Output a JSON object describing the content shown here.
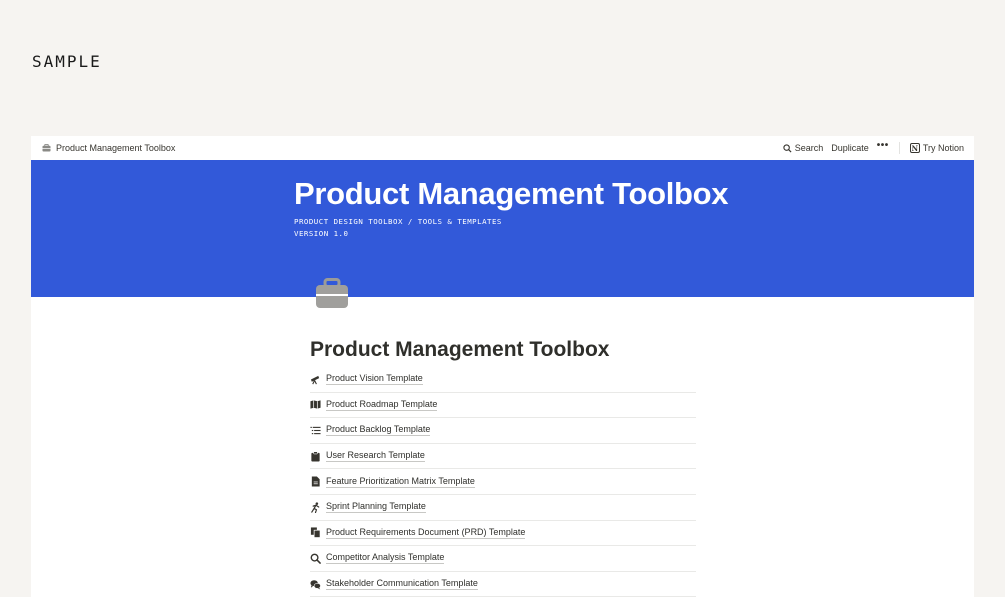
{
  "watermark": "SAMPLE",
  "topbar": {
    "breadcrumb": "Product Management Toolbox",
    "search_label": "Search",
    "duplicate_label": "Duplicate",
    "more_label": "•••",
    "notion_logo": "N",
    "try_label": "Try Notion"
  },
  "cover": {
    "title": "Product Management Toolbox",
    "subtitle_line1": "PRODUCT DESIGN TOOLBOX / TOOLS & TEMPLATES",
    "subtitle_line2": "VERSION 1.0",
    "color": "#3259d9"
  },
  "page": {
    "icon": "briefcase-icon",
    "title": "Product Management Toolbox"
  },
  "links": [
    {
      "label": "Product Vision Template",
      "icon": "telescope-icon"
    },
    {
      "label": "Product Roadmap Template",
      "icon": "map-icon"
    },
    {
      "label": "Product Backlog Template",
      "icon": "list-icon"
    },
    {
      "label": "User Research Template",
      "icon": "clipboard-icon"
    },
    {
      "label": "Feature Prioritization Matrix Template",
      "icon": "document-icon"
    },
    {
      "label": "Sprint Planning Template",
      "icon": "runner-icon"
    },
    {
      "label": "Product Requirements Document (PRD) Template",
      "icon": "documents-icon"
    },
    {
      "label": "Competitor Analysis Template",
      "icon": "magnifier-icon"
    },
    {
      "label": "Stakeholder Communication Template",
      "icon": "chat-bubbles-icon"
    }
  ]
}
